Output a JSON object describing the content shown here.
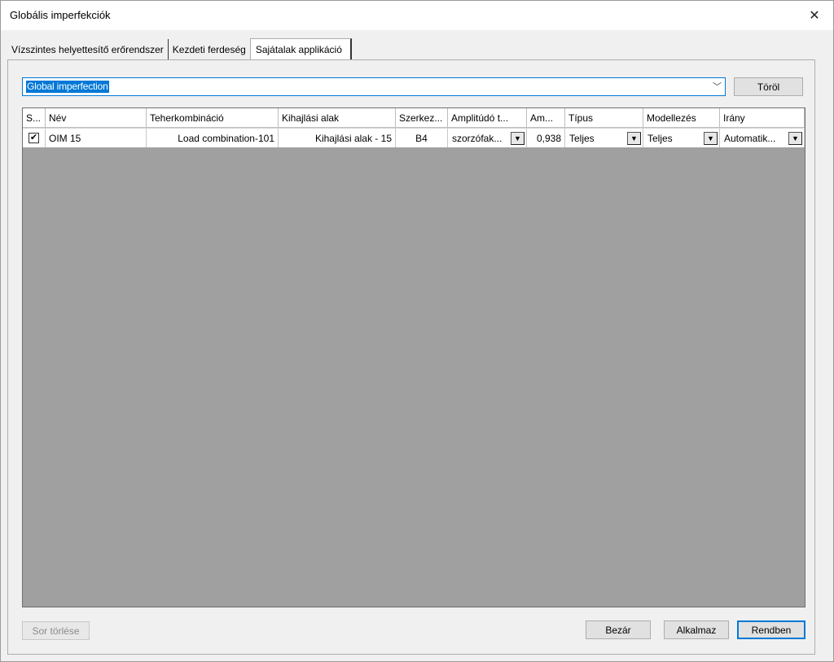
{
  "window": {
    "title": "Globális imperfekciók"
  },
  "tabs": [
    {
      "label": "Vízszintes helyettesítő erőrendszer"
    },
    {
      "label": "Kezdeti ferdeség"
    },
    {
      "label": "Sajátalak applikáció"
    }
  ],
  "selector": {
    "value": "Global imperfection",
    "delete_label": "Töröl"
  },
  "grid": {
    "columns": [
      "S...",
      "Név",
      "Teherkombináció",
      "Kihajlási alak",
      "Szerkez...",
      "Amplitúdó t...",
      "Am...",
      "Típus",
      "Modellezés",
      "Irány"
    ],
    "rows": [
      {
        "checked": "✔",
        "name": "OIM 15",
        "load_combination": "Load combination-101",
        "buckling_shape": "Kihajlási alak - 15",
        "structure": "B4",
        "amplitude_type": "szorzófak...",
        "amplitude": "0,938",
        "type": "Teljes",
        "modelling": "Teljes",
        "direction": "Automatik..."
      }
    ]
  },
  "buttons": {
    "delete_row": "Sor törlése",
    "close": "Bezár",
    "apply": "Alkalmaz",
    "ok": "Rendben"
  },
  "icons": {
    "close": "close-icon",
    "dropdown": "chevron-down-icon",
    "cell_dropdown": "triangle-down-icon"
  },
  "colors": {
    "accent": "#0078d7",
    "grid_background": "#a0a0a0"
  }
}
